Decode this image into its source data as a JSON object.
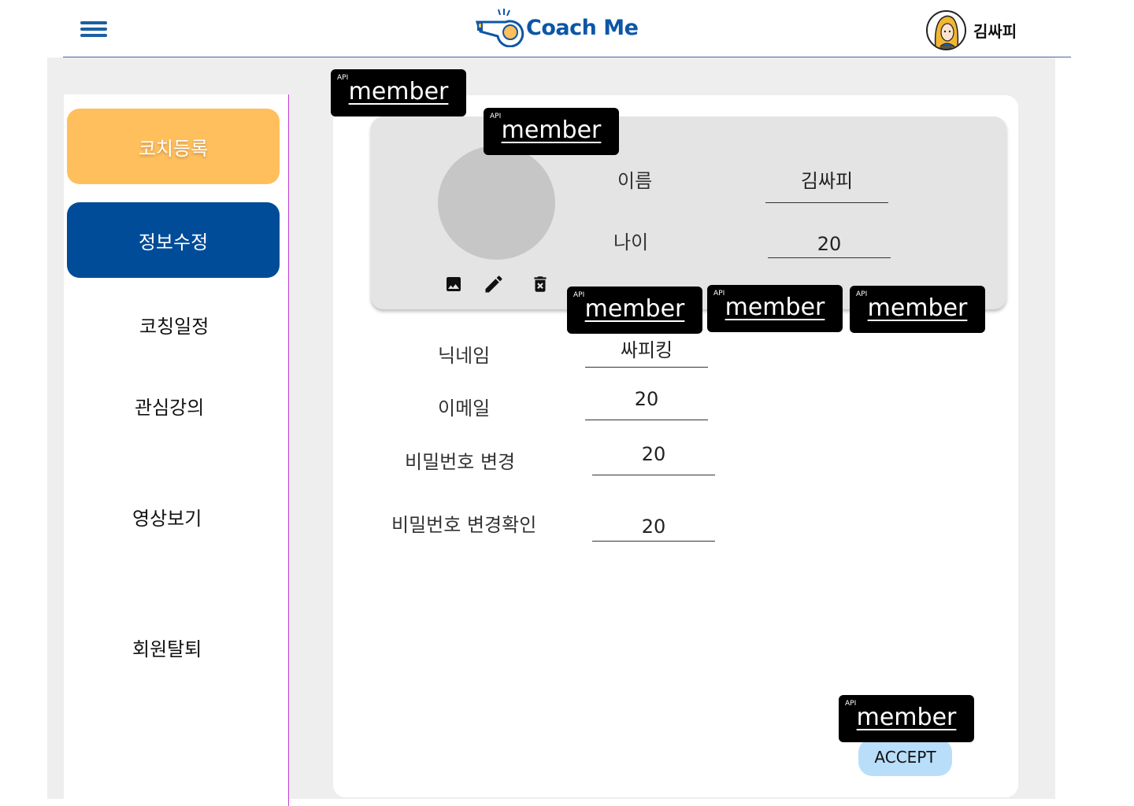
{
  "header": {
    "logo_text": "Coach Me",
    "user_name": "김싸피",
    "menu_icon": "hamburger-menu-icon",
    "accent_color": "#0c56a6"
  },
  "sidebar": {
    "items": [
      {
        "label": "코치등록",
        "style": "orange",
        "color": "#ffbf5c"
      },
      {
        "label": "정보수정",
        "style": "blue",
        "color": "#004c98",
        "active": true
      },
      {
        "label": "코칭일정"
      },
      {
        "label": "관심강의"
      },
      {
        "label": "영상보기"
      },
      {
        "label": "회원탈퇴"
      }
    ]
  },
  "profile": {
    "name_label": "이름",
    "name_value": "김싸피",
    "age_label": "나이",
    "age_value": "20",
    "photo_icons": [
      "image-icon",
      "edit-pencil-icon",
      "delete-icon"
    ]
  },
  "form": {
    "nickname_label": "닉네임",
    "nickname_value": "싸피킹",
    "email_label": "이메일",
    "email_value": "20",
    "password_label": "비밀번호 변경",
    "password_value": "20",
    "password_confirm_label": "비밀번호 변경확인",
    "password_confirm_value": "20"
  },
  "api_tags": {
    "small": "API",
    "text": "member"
  },
  "accept_label": "ACCEPT"
}
